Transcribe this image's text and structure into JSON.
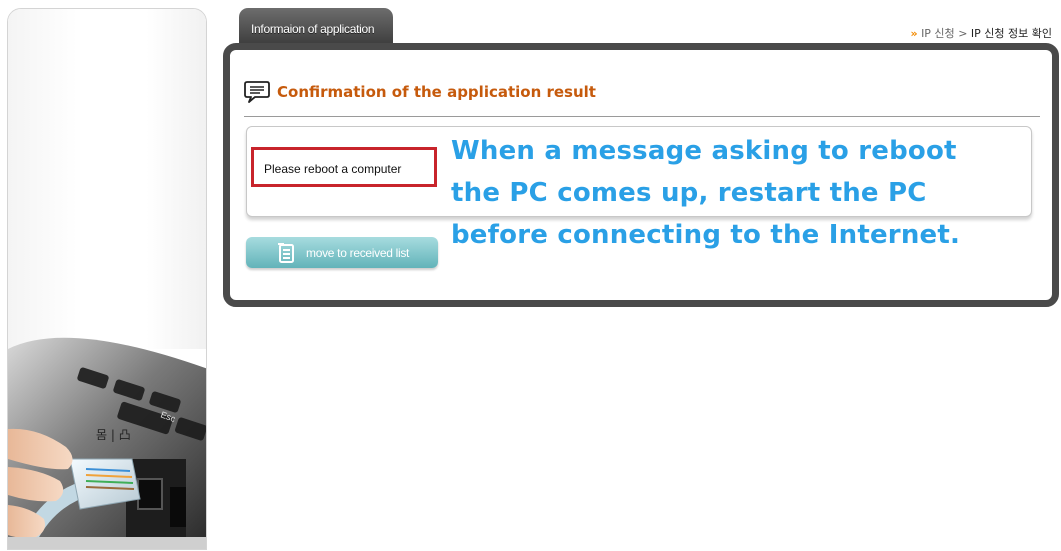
{
  "tab": {
    "label": "Informaion of application"
  },
  "breadcrumb": {
    "arrow": "»",
    "items": [
      "IP 신청",
      "IP 신청 정보 확인"
    ],
    "separator": ">"
  },
  "section": {
    "title": "Confirmation of the application result",
    "icon": "speech-bubble-icon"
  },
  "message": {
    "text": "Please reboot a computer"
  },
  "button": {
    "label": "move to received list",
    "icon": "list-icon"
  },
  "annotation": {
    "lines": [
      "When a message asking to reboot",
      "the PC comes up, restart the PC",
      "before connecting to the Internet."
    ]
  },
  "colors": {
    "tab_background": "#4a4a4a",
    "frame_border": "#4a4a4a",
    "title_text": "#c65a0c",
    "highlight_box": "#c8242b",
    "button_teal": "#62b3b9",
    "annotation_text": "#2aa0e6",
    "breadcrumb_arrow": "#f28a00"
  }
}
